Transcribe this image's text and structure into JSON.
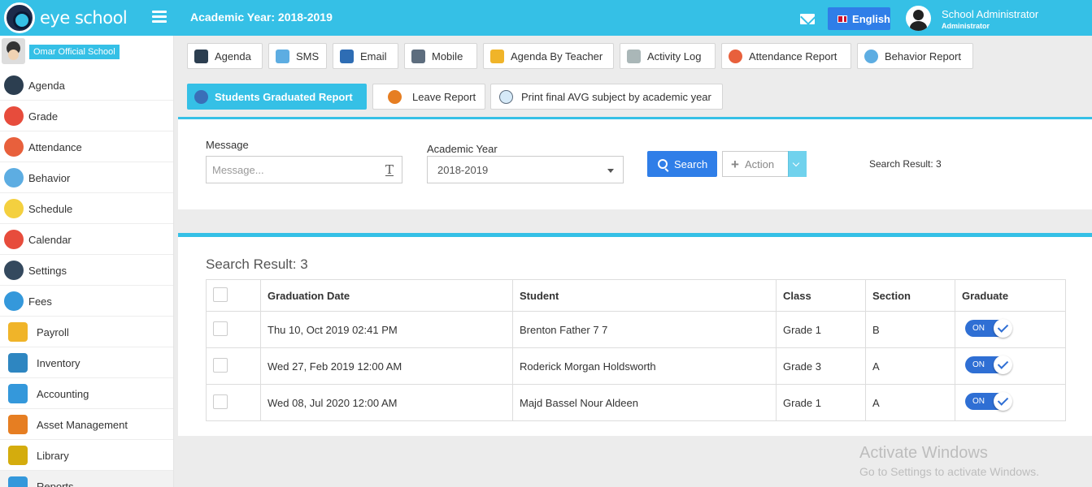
{
  "header": {
    "brand": "eye school",
    "academic_year_title": "Academic Year: 2018-2019",
    "language": "English",
    "user_name": "School Administrator",
    "user_role": "Administrator"
  },
  "sidebar": {
    "school_name": "Omar Official School",
    "items": [
      {
        "label": "Agenda",
        "icon": "agenda-icon",
        "color": "#2c3e50"
      },
      {
        "label": "Grade",
        "icon": "grade-icon",
        "color": "#e74c3c"
      },
      {
        "label": "Attendance",
        "icon": "attendance-icon",
        "color": "#e8603c"
      },
      {
        "label": "Behavior",
        "icon": "behavior-icon",
        "color": "#5dade2"
      },
      {
        "label": "Schedule",
        "icon": "schedule-icon",
        "color": "#f4d03f"
      },
      {
        "label": "Calendar",
        "icon": "calendar-icon",
        "color": "#e74c3c"
      },
      {
        "label": "Settings",
        "icon": "settings-icon",
        "color": "#34495e"
      },
      {
        "label": "Fees",
        "icon": "fees-icon",
        "color": "#3498db"
      },
      {
        "label": "Payroll",
        "icon": "payroll-icon",
        "color": "#f0b429"
      },
      {
        "label": "Inventory",
        "icon": "inventory-icon",
        "color": "#2e86c1"
      },
      {
        "label": "Accounting",
        "icon": "accounting-icon",
        "color": "#3498db"
      },
      {
        "label": "Asset Management",
        "icon": "asset-management-icon",
        "color": "#e67e22"
      },
      {
        "label": "Library",
        "icon": "library-icon",
        "color": "#d4ac0d"
      },
      {
        "label": "Reports",
        "icon": "reports-icon",
        "color": "#3498db"
      }
    ]
  },
  "report_buttons": {
    "agenda": "Agenda",
    "sms": "SMS",
    "email": "Email",
    "mobile": "Mobile",
    "agenda_by_teacher": "Agenda By Teacher",
    "activity_log": "Activity Log",
    "attendance_report": "Attendance Report",
    "behavior_report": "Behavior Report",
    "students_graduated_report": "Students Graduated Report",
    "leave_report": "Leave Report",
    "print_final_avg": "Print final AVG subject by academic year"
  },
  "filters": {
    "message_label": "Message",
    "message_placeholder": "Message...",
    "academic_year_label": "Academic Year",
    "academic_year_value": "2018-2019",
    "search_label": "Search",
    "action_label": "Action",
    "search_result_small": "Search Result: 3"
  },
  "results": {
    "title": "Search Result: 3",
    "columns": [
      "Graduation Date",
      "Student",
      "Class",
      "Section",
      "Graduate"
    ],
    "rows": [
      {
        "date": "Thu 10, Oct 2019 02:41 PM",
        "student": "Brenton Father 7 7",
        "class": "Grade 1",
        "section": "B",
        "graduate": "ON"
      },
      {
        "date": "Wed 27, Feb 2019 12:00 AM",
        "student": "Roderick Morgan Holdsworth",
        "class": "Grade 3",
        "section": "A",
        "graduate": "ON"
      },
      {
        "date": "Wed 08, Jul 2020 12:00 AM",
        "student": "Majd Bassel Nour Aldeen",
        "class": "Grade 1",
        "section": "A",
        "graduate": "ON"
      }
    ]
  },
  "watermark": {
    "line1": "Activate Windows",
    "line2": "Go to Settings to activate Windows."
  },
  "colors": {
    "primary": "#35c0e6",
    "button_blue": "#2f7ee8",
    "toggle_blue": "#2f6fd4"
  }
}
